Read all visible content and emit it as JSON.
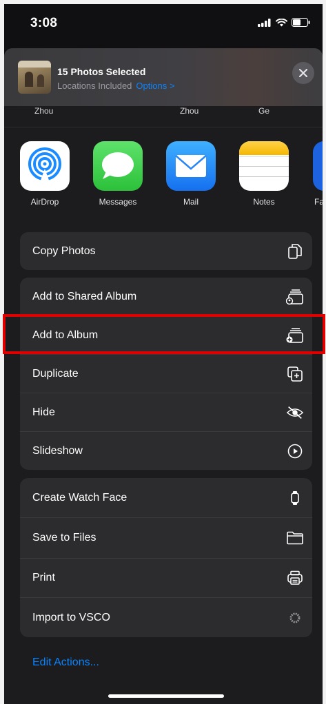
{
  "status_bar": {
    "time": "3:08"
  },
  "share_header": {
    "title": "15 Photos Selected",
    "subtitle": "Locations Included",
    "options_label": "Options >"
  },
  "people_row": [
    "Zhou",
    "Zhou",
    "Ge"
  ],
  "apps": [
    {
      "label": "AirDrop",
      "icon": "airdrop-icon"
    },
    {
      "label": "Messages",
      "icon": "messages-icon"
    },
    {
      "label": "Mail",
      "icon": "mail-icon"
    },
    {
      "label": "Notes",
      "icon": "notes-icon"
    },
    {
      "label": "Fa",
      "icon": "facebook-icon"
    }
  ],
  "actions": {
    "group1": [
      {
        "label": "Copy Photos",
        "icon": "copy-photos-icon"
      }
    ],
    "group2": [
      {
        "label": "Add to Shared Album",
        "icon": "shared-album-icon"
      },
      {
        "label": "Add to Album",
        "icon": "add-album-icon"
      },
      {
        "label": "Duplicate",
        "icon": "duplicate-icon"
      },
      {
        "label": "Hide",
        "icon": "hide-eye-icon"
      },
      {
        "label": "Slideshow",
        "icon": "play-icon"
      }
    ],
    "group3": [
      {
        "label": "Create Watch Face",
        "icon": "watch-icon"
      },
      {
        "label": "Save to Files",
        "icon": "folder-icon"
      },
      {
        "label": "Print",
        "icon": "printer-icon"
      },
      {
        "label": "Import to VSCO",
        "icon": "vsco-icon"
      }
    ]
  },
  "edit_actions_label": "Edit Actions...",
  "colors": {
    "accent": "#0a84ff",
    "highlight": "#e00000",
    "sheet_bg": "#1c1c1e",
    "cell_bg": "#2c2c2e"
  }
}
